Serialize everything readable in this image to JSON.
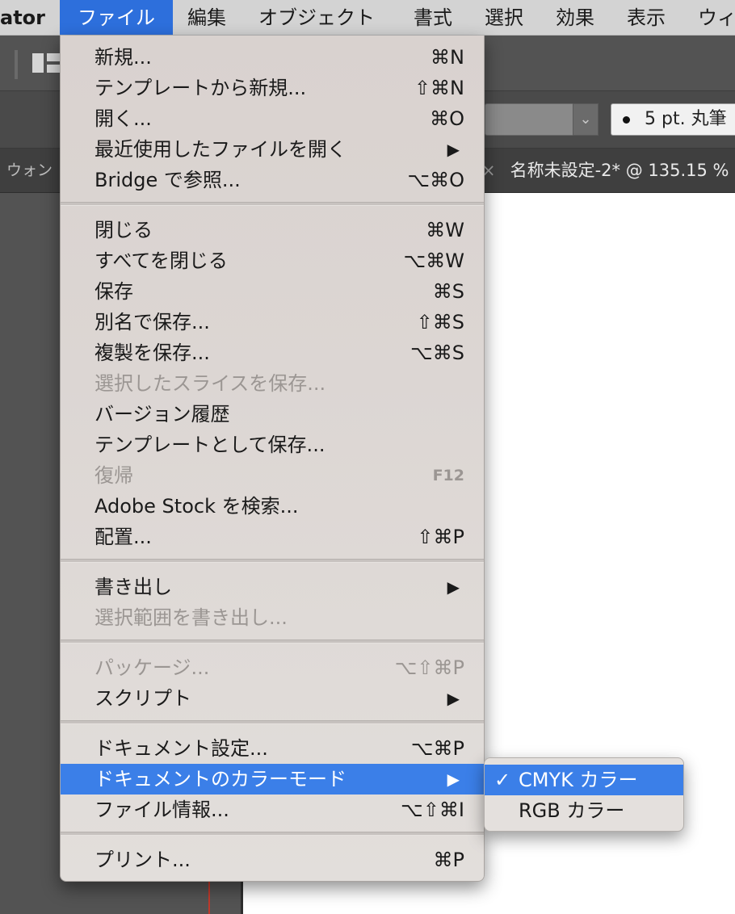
{
  "menubar": {
    "app_name": "ator",
    "items": [
      "ファイル",
      "編集",
      "オブジェクト",
      "書式",
      "選択",
      "効果",
      "表示",
      "ウィ"
    ]
  },
  "toolbar": {
    "stroke_value": "5 pt. 丸筆"
  },
  "tabs": {
    "left_panel_tab": "ウォン",
    "document_tab": "名称未設定-2* @ 135.15 %",
    "close_glyph": "×"
  },
  "file_menu": {
    "items": [
      {
        "label": "新規...",
        "shortcut": "⌘N"
      },
      {
        "label": "テンプレートから新規...",
        "shortcut": "⇧⌘N"
      },
      {
        "label": "開く...",
        "shortcut": "⌘O"
      },
      {
        "label": "最近使用したファイルを開く",
        "shortcut": "▶"
      },
      {
        "label": "Bridge で参照...",
        "shortcut": "⌥⌘O"
      },
      {
        "label": "閉じる",
        "shortcut": "⌘W"
      },
      {
        "label": "すべてを閉じる",
        "shortcut": "⌥⌘W"
      },
      {
        "label": "保存",
        "shortcut": "⌘S"
      },
      {
        "label": "別名で保存...",
        "shortcut": "⇧⌘S"
      },
      {
        "label": "複製を保存...",
        "shortcut": "⌥⌘S"
      },
      {
        "label": "選択したスライスを保存...",
        "shortcut": ""
      },
      {
        "label": "バージョン履歴",
        "shortcut": ""
      },
      {
        "label": "テンプレートとして保存...",
        "shortcut": ""
      },
      {
        "label": "復帰",
        "shortcut": "F12"
      },
      {
        "label": "Adobe Stock を検索...",
        "shortcut": ""
      },
      {
        "label": "配置...",
        "shortcut": "⇧⌘P"
      },
      {
        "label": "書き出し",
        "shortcut": "▶"
      },
      {
        "label": "選択範囲を書き出し...",
        "shortcut": ""
      },
      {
        "label": "パッケージ...",
        "shortcut": "⌥⇧⌘P"
      },
      {
        "label": "スクリプト",
        "shortcut": "▶"
      },
      {
        "label": "ドキュメント設定...",
        "shortcut": "⌥⌘P"
      },
      {
        "label": "ドキュメントのカラーモード",
        "shortcut": "▶"
      },
      {
        "label": "ファイル情報...",
        "shortcut": "⌥⇧⌘I"
      },
      {
        "label": "プリント...",
        "shortcut": "⌘P"
      }
    ]
  },
  "color_mode_submenu": {
    "checkmark": "✓",
    "items": [
      "CMYK カラー",
      "RGB カラー"
    ]
  }
}
